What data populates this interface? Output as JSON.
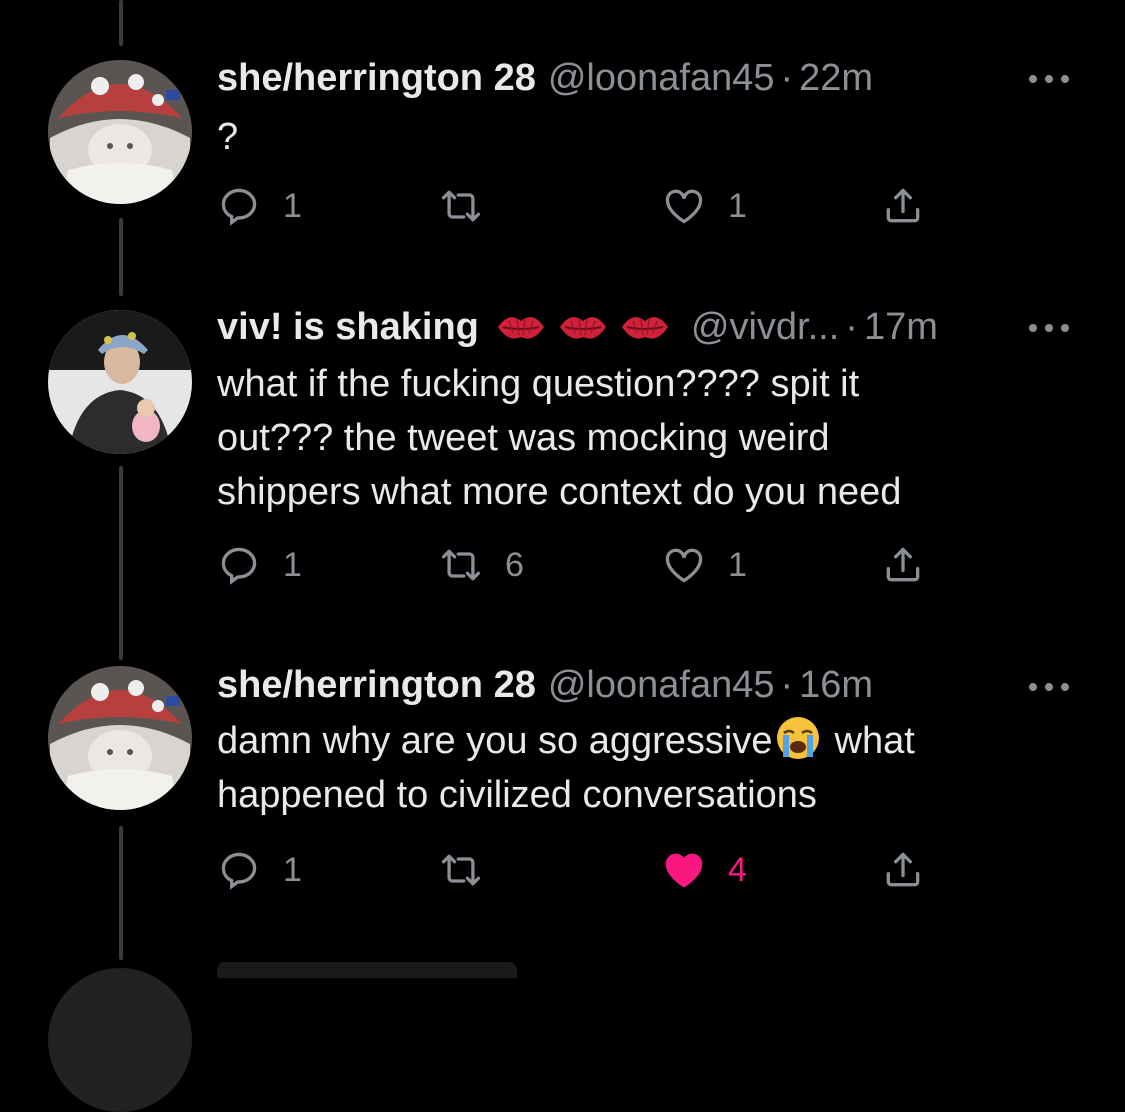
{
  "tweets": [
    {
      "name": "she/herrington 28",
      "handle": "@loonafan45",
      "separator": "·",
      "time": "22m",
      "lines": [
        "?"
      ],
      "reply_count": "1",
      "retweet_count": "",
      "like_count": "1",
      "liked": false
    },
    {
      "name": "viv! is shaking",
      "handle": "@vivdr...",
      "separator": "·",
      "time": "17m",
      "lines": [
        "what if the fucking question???? spit it",
        "out??? the tweet was mocking weird",
        "shippers what more context do you need"
      ],
      "reply_count": "1",
      "retweet_count": "6",
      "like_count": "1",
      "liked": false
    },
    {
      "name": "she/herrington 28",
      "handle": "@loonafan45",
      "separator": "·",
      "time": "16m",
      "lines": [
        "damn why are you so aggressive",
        "what",
        "happened to civilized conversations"
      ],
      "reply_count": "1",
      "retweet_count": "",
      "like_count": "4",
      "liked": true
    }
  ],
  "icons": {
    "reply": "reply-icon",
    "retweet": "retweet-icon",
    "like": "heart-icon",
    "share": "share-icon",
    "more": "more-icon",
    "kiss": "kiss-mark-icon",
    "crying": "loudly-crying-face-icon"
  },
  "colors": {
    "background": "#000000",
    "text": "#e7e9ea",
    "muted": "#8b9096",
    "liked": "#f91880",
    "thread_line": "#3a3d40"
  }
}
